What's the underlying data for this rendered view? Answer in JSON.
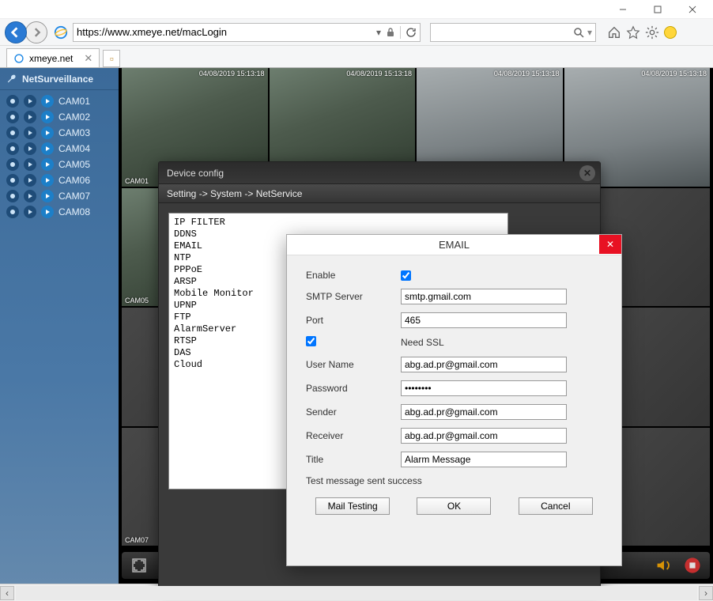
{
  "window": {
    "minimize": "—",
    "maximize": "▢",
    "close": "✕"
  },
  "browser": {
    "url": "https://www.xmeye.net/macLogin",
    "search_placeholder": "",
    "tab_title": "xmeye.net"
  },
  "sidebar": {
    "title": "NetSurveillance",
    "cams": [
      "CAM01",
      "CAM02",
      "CAM03",
      "CAM04",
      "CAM05",
      "CAM06",
      "CAM07",
      "CAM08"
    ]
  },
  "dialog": {
    "title": "Device config",
    "breadcrumb": "Setting -> System -> NetService",
    "services": [
      "IP FILTER",
      "DDNS",
      "EMAIL",
      "NTP",
      "PPPoE",
      "ARSP",
      "Mobile Monitor",
      "UPNP",
      "FTP",
      "AlarmServer",
      "RTSP",
      "DAS",
      "Cloud"
    ]
  },
  "email": {
    "title": "EMAIL",
    "labels": {
      "enable": "Enable",
      "smtp": "SMTP Server",
      "port": "Port",
      "ssl": "Need SSL",
      "user": "User Name",
      "pass": "Password",
      "sender": "Sender",
      "receiver": "Receiver",
      "subject": "Title"
    },
    "values": {
      "smtp": "smtp.gmail.com",
      "port": "465",
      "user": "abg.ad.pr@gmail.com",
      "pass": "••••••••",
      "sender": "abg.ad.pr@gmail.com",
      "receiver": "abg.ad.pr@gmail.com",
      "subject": "Alarm Message"
    },
    "status": "Test message sent success",
    "buttons": {
      "test": "Mail Testing",
      "ok": "OK",
      "cancel": "Cancel"
    }
  }
}
